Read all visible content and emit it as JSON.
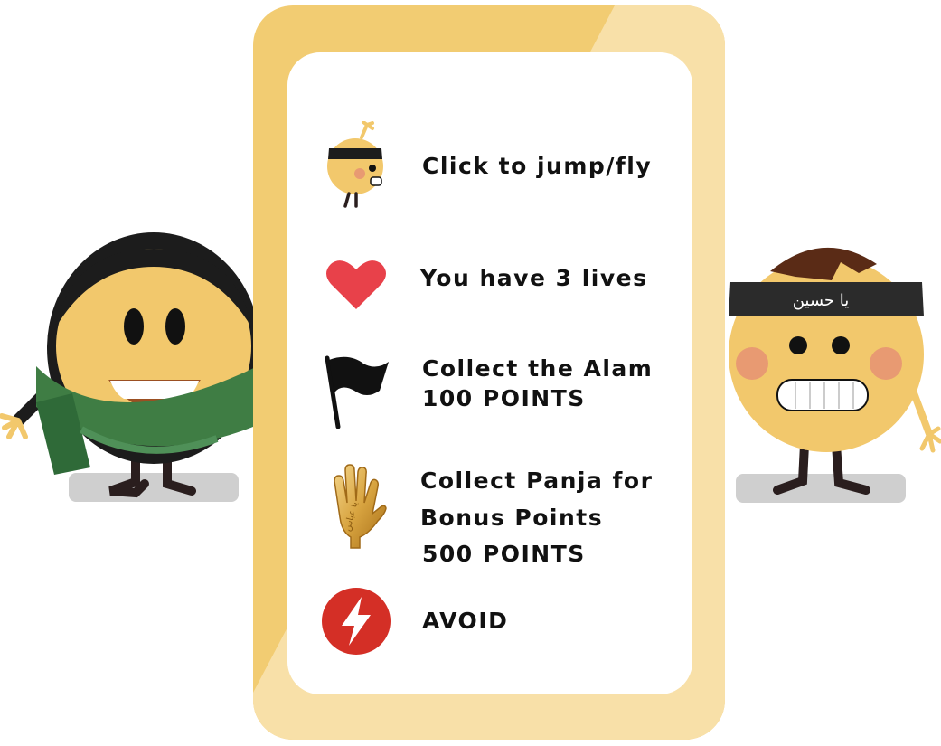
{
  "instructions": [
    {
      "icon": "jumping-character-icon",
      "lines": [
        "Click to jump/fly"
      ]
    },
    {
      "icon": "heart-icon",
      "lines": [
        "You have 3 lives"
      ]
    },
    {
      "icon": "flag-icon",
      "lines": [
        "Collect the Alam",
        "100 POINTS"
      ]
    },
    {
      "icon": "panja-hand-icon",
      "lines": [
        "Collect Panja for",
        "Bonus Points",
        "500 POINTS"
      ]
    },
    {
      "icon": "lightning-icon",
      "lines": [
        "AVOID"
      ]
    }
  ],
  "right_character": {
    "headband_text": "يا حسين"
  },
  "panja_inscription": "يا عباس",
  "colors": {
    "panel": "#f2cc72",
    "panel_light": "#f8e0a8",
    "face": "#f2c86c",
    "heart": "#e8414a",
    "avoid": "#d42f26",
    "scarf": "#3a7a42",
    "hijab": "#1c1c1c",
    "headband": "#2b2b2b",
    "hair": "#5a2b16"
  }
}
